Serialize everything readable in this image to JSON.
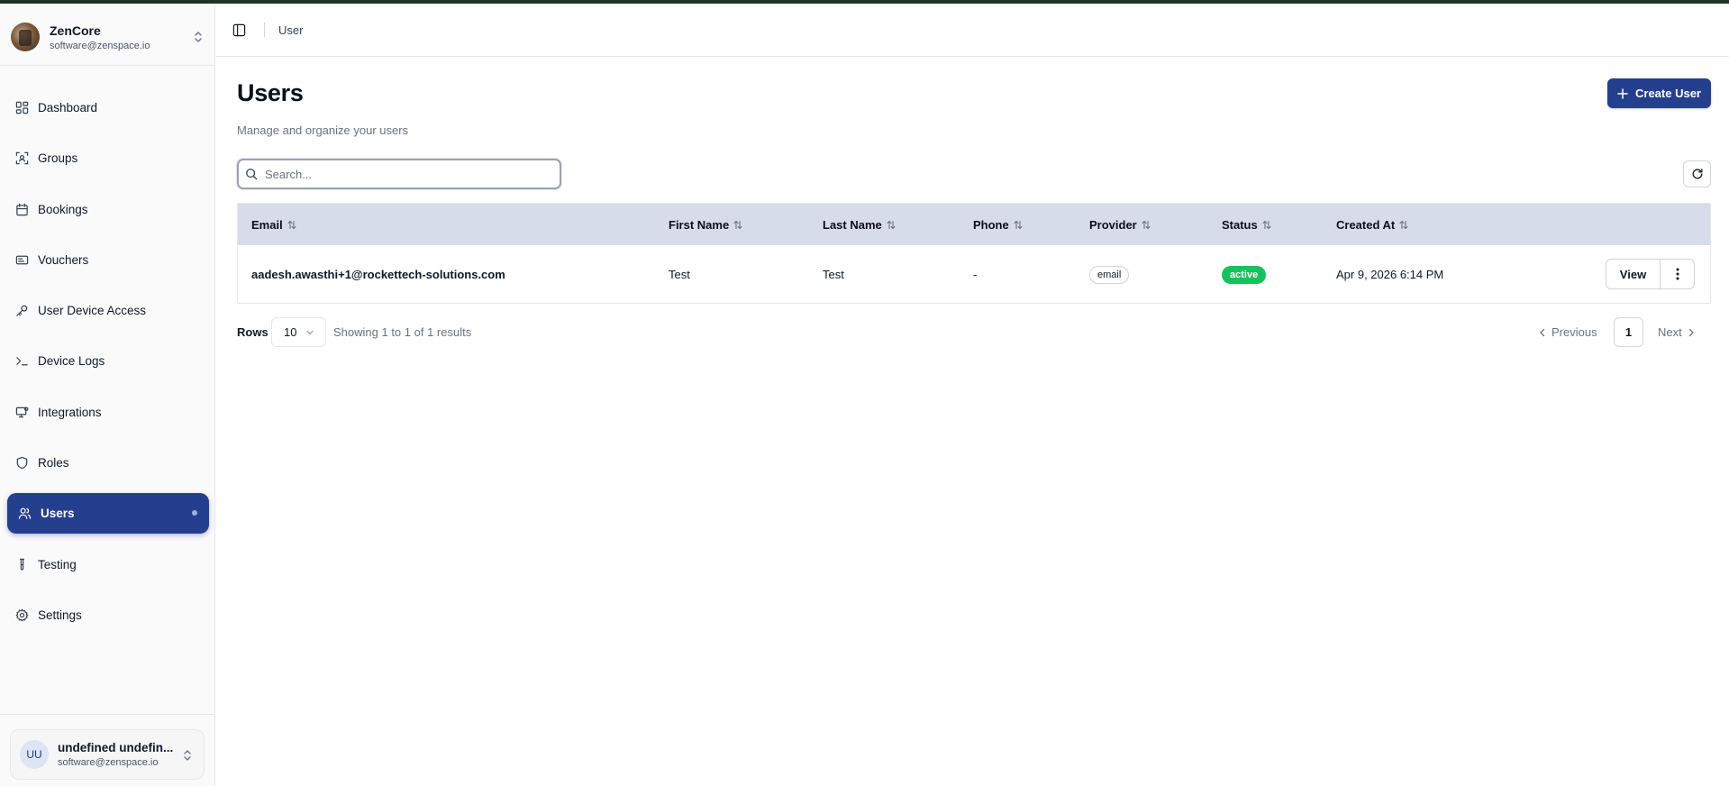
{
  "app": {
    "org_name": "ZenCore",
    "org_email": "software@zenspace.io"
  },
  "sidebar": {
    "items": [
      {
        "label": "Dashboard",
        "icon": "dashboard-icon"
      },
      {
        "label": "Groups",
        "icon": "groups-icon"
      },
      {
        "label": "Bookings",
        "icon": "calendar-icon"
      },
      {
        "label": "Vouchers",
        "icon": "ticket-icon"
      },
      {
        "label": "User Device Access",
        "icon": "key-icon"
      },
      {
        "label": "Device Logs",
        "icon": "terminal-icon"
      },
      {
        "label": "Integrations",
        "icon": "monitor-icon"
      },
      {
        "label": "Roles",
        "icon": "shield-icon"
      },
      {
        "label": "Users",
        "icon": "users-icon",
        "active": true
      },
      {
        "label": "Testing",
        "icon": "test-tube-icon"
      },
      {
        "label": "Settings",
        "icon": "gear-icon"
      }
    ],
    "user": {
      "initials": "UU",
      "name": "undefined undefin...",
      "email": "software@zenspace.io"
    }
  },
  "header": {
    "breadcrumb": "User"
  },
  "main": {
    "title": "Users",
    "subtitle": "Manage and organize your users",
    "create_button": "Create User",
    "search_placeholder": "Search...",
    "table": {
      "columns": [
        "Email",
        "First Name",
        "Last Name",
        "Phone",
        "Provider",
        "Status",
        "Created At"
      ],
      "rows": [
        {
          "email": "aadesh.awasthi+1@rockettech-solutions.com",
          "first_name": "Test",
          "last_name": "Test",
          "phone": "-",
          "provider": "email",
          "status": "active",
          "created_at": "Apr 9, 2026 6:14 PM",
          "view_label": "View"
        }
      ]
    },
    "pagination": {
      "rows_label": "Rows",
      "rows_value": "10",
      "showing": "Showing 1 to 1 of 1 results",
      "previous": "Previous",
      "current_page": "1",
      "next": "Next"
    }
  },
  "colors": {
    "accent": "#253f8f",
    "table_header": "#d7dce9",
    "status_active": "#16c35a"
  }
}
